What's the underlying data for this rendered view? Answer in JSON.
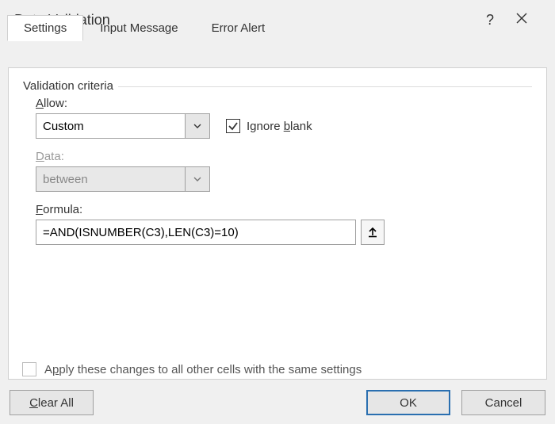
{
  "title": "Data Validation",
  "tabs": {
    "settings": "Settings",
    "input_message": "Input Message",
    "error_alert": "Error Alert"
  },
  "fieldset_label": "Validation criteria",
  "allow": {
    "label_pre": "",
    "label_u": "A",
    "label_post": "llow:",
    "value": "Custom"
  },
  "ignore_blank": {
    "pre": "Ignore ",
    "u": "b",
    "post": "lank",
    "checked": true
  },
  "data": {
    "label_pre": "",
    "label_u": "D",
    "label_post": "ata:",
    "value": "between"
  },
  "formula": {
    "label_pre": "",
    "label_u": "F",
    "label_post": "ormula:",
    "value": "=AND(ISNUMBER(C3),LEN(C3)=10)"
  },
  "apply": {
    "pre": "A",
    "u": "p",
    "post": "ply these changes to all other cells with the same settings",
    "checked": false
  },
  "buttons": {
    "clear_pre": "",
    "clear_u": "C",
    "clear_post": "lear All",
    "ok": "OK",
    "cancel": "Cancel"
  }
}
